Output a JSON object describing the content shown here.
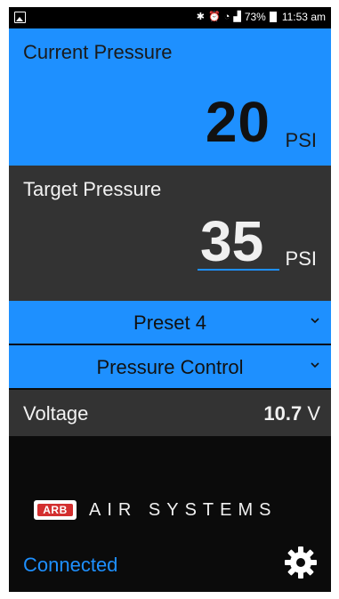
{
  "status_bar": {
    "left_icon": "image-icon",
    "icons": [
      "bluetooth-icon",
      "alarm-icon",
      "wifi-icon",
      "signal-icon"
    ],
    "battery": "73%",
    "time": "11:53 am"
  },
  "current": {
    "label": "Current Pressure",
    "value": "20",
    "unit": "PSI"
  },
  "target": {
    "label": "Target Pressure",
    "value": "35",
    "unit": "PSI"
  },
  "preset_dropdown": {
    "label": "Preset 4",
    "icon": "chevron-down-icon"
  },
  "mode_dropdown": {
    "label": "Pressure Control",
    "icon": "chevron-down-icon"
  },
  "voltage": {
    "label": "Voltage",
    "value": "10.7",
    "unit": "V"
  },
  "brand": {
    "logo_text": "ARB",
    "tagline": "AIR SYSTEMS"
  },
  "footer": {
    "status": "Connected",
    "settings_icon": "gear-icon"
  },
  "colors": {
    "accent": "#1e90ff",
    "panel": "#333333",
    "background": "#0b0b0b"
  }
}
